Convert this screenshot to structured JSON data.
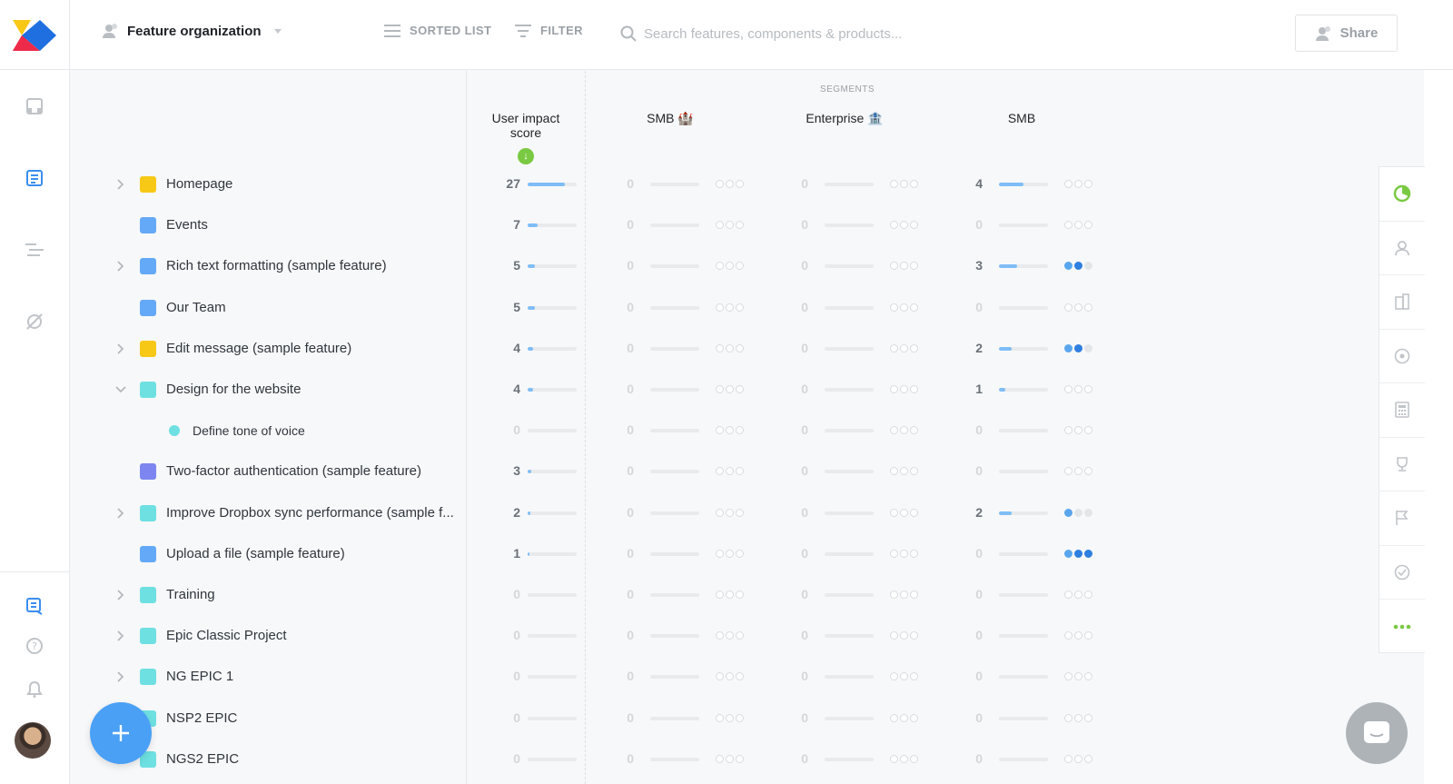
{
  "header": {
    "view_title": "Feature organization",
    "sorted_list_label": "SORTED LIST",
    "filter_label": "FILTER",
    "search_placeholder": "Search features, components & products...",
    "share_label": "Share"
  },
  "columns": {
    "segments_label": "SEGMENTS",
    "score_header": "User impact score",
    "segment_headers": [
      "SMB 🏰",
      "Enterprise 🏦",
      "SMB"
    ]
  },
  "colors": {
    "yellow": "#f8c817",
    "blue": "#64a9f7",
    "teal": "#6ee0e2",
    "purple": "#7d86f0",
    "accent_green": "#7ac943"
  },
  "rows": [
    {
      "name": "Homepage",
      "color": "yellow",
      "expandable": true,
      "score": "27",
      "segments": [
        {
          "value": "0",
          "dots": 0
        },
        {
          "value": "0",
          "dots": 0
        },
        {
          "value": "4",
          "dots": 0
        }
      ]
    },
    {
      "name": "Events",
      "color": "blue",
      "expandable": false,
      "score": "7",
      "segments": [
        {
          "value": "0",
          "dots": 0
        },
        {
          "value": "0",
          "dots": 0
        },
        {
          "value": "0",
          "dots": 0
        }
      ]
    },
    {
      "name": "Rich text formatting (sample feature)",
      "color": "blue",
      "expandable": true,
      "score": "5",
      "segments": [
        {
          "value": "0",
          "dots": 0
        },
        {
          "value": "0",
          "dots": 0
        },
        {
          "value": "3",
          "dots": 2
        }
      ]
    },
    {
      "name": "Our Team",
      "color": "blue",
      "expandable": false,
      "score": "5",
      "segments": [
        {
          "value": "0",
          "dots": 0
        },
        {
          "value": "0",
          "dots": 0
        },
        {
          "value": "0",
          "dots": 0
        }
      ]
    },
    {
      "name": "Edit message (sample feature)",
      "color": "yellow",
      "expandable": true,
      "score": "4",
      "segments": [
        {
          "value": "0",
          "dots": 0
        },
        {
          "value": "0",
          "dots": 0
        },
        {
          "value": "2",
          "dots": 2
        }
      ]
    },
    {
      "name": "Design for the website",
      "color": "teal",
      "expandable": true,
      "expanded": true,
      "score": "4",
      "segments": [
        {
          "value": "0",
          "dots": 0
        },
        {
          "value": "0",
          "dots": 0
        },
        {
          "value": "1",
          "dots": 0
        }
      ]
    },
    {
      "name": "Define tone of voice",
      "color": "teal",
      "subfeature": true,
      "score": "0",
      "segments": [
        {
          "value": "0",
          "dots": 0
        },
        {
          "value": "0",
          "dots": 0
        },
        {
          "value": "0",
          "dots": 0
        }
      ]
    },
    {
      "name": "Two-factor authentication (sample feature)",
      "color": "purple",
      "expandable": false,
      "score": "3",
      "segments": [
        {
          "value": "0",
          "dots": 0
        },
        {
          "value": "0",
          "dots": 0
        },
        {
          "value": "0",
          "dots": 0
        }
      ]
    },
    {
      "name": "Improve Dropbox sync performance (sample f...",
      "color": "teal",
      "expandable": true,
      "score": "2",
      "segments": [
        {
          "value": "0",
          "dots": 0
        },
        {
          "value": "0",
          "dots": 0
        },
        {
          "value": "2",
          "dots": 1
        }
      ]
    },
    {
      "name": "Upload a file (sample feature)",
      "color": "blue",
      "expandable": false,
      "score": "1",
      "segments": [
        {
          "value": "0",
          "dots": 0
        },
        {
          "value": "0",
          "dots": 0
        },
        {
          "value": "0",
          "dots": 3
        }
      ]
    },
    {
      "name": "Training",
      "color": "teal",
      "expandable": true,
      "score": "0",
      "segments": [
        {
          "value": "0",
          "dots": 0
        },
        {
          "value": "0",
          "dots": 0
        },
        {
          "value": "0",
          "dots": 0
        }
      ]
    },
    {
      "name": "Epic Classic Project",
      "color": "teal",
      "expandable": true,
      "score": "0",
      "segments": [
        {
          "value": "0",
          "dots": 0
        },
        {
          "value": "0",
          "dots": 0
        },
        {
          "value": "0",
          "dots": 0
        }
      ]
    },
    {
      "name": "NG EPIC 1",
      "color": "teal",
      "expandable": true,
      "score": "0",
      "segments": [
        {
          "value": "0",
          "dots": 0
        },
        {
          "value": "0",
          "dots": 0
        },
        {
          "value": "0",
          "dots": 0
        }
      ]
    },
    {
      "name": "NSP2 EPIC",
      "color": "teal",
      "expandable": true,
      "score": "0",
      "segments": [
        {
          "value": "0",
          "dots": 0
        },
        {
          "value": "0",
          "dots": 0
        },
        {
          "value": "0",
          "dots": 0
        }
      ]
    },
    {
      "name": "NGS2 EPIC",
      "color": "teal",
      "expandable": true,
      "score": "0",
      "segments": [
        {
          "value": "0",
          "dots": 0
        },
        {
          "value": "0",
          "dots": 0
        },
        {
          "value": "0",
          "dots": 0
        }
      ]
    }
  ],
  "score_fill_max": 27,
  "segment_fill_max": 8,
  "left_rail_icons": [
    "inbox-icon",
    "feature-board-icon",
    "roadmap-icon",
    "insights-icon",
    "portal-icon",
    "help-icon",
    "notifications-icon"
  ],
  "right_rail_icons": [
    "score-pie-icon",
    "user-icon",
    "company-icon",
    "target-icon",
    "calculator-icon",
    "trophy-icon",
    "flag-icon",
    "check-circle-icon",
    "more-icon"
  ]
}
